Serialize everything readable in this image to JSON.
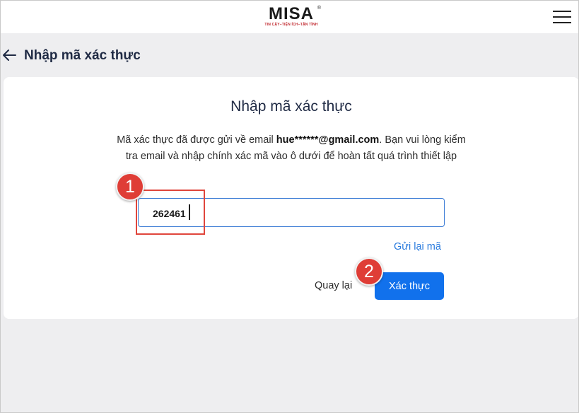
{
  "brand": {
    "logo_text": "MISA",
    "registered_mark": "®",
    "slogan": "TIN CẬY–TIỆN ÍCH–TẬN TÌNH"
  },
  "header": {
    "menu_icon": "hamburger-menu-icon",
    "back_icon": "arrow-left-icon",
    "title": "Nhập mã xác thực"
  },
  "card": {
    "title": "Nhập mã xác thực",
    "desc_prefix": "Mã xác thực đã được gửi về email ",
    "email": "hue******@gmail.com",
    "desc_suffix": ". Bạn vui lòng kiểm tra email và nhập chính xác mã vào ô dưới để hoàn tất quá trình thiết lập",
    "code_value": "262461",
    "resend_label": "Gửi lại mã",
    "back_label": "Quay lại",
    "verify_label": "Xác thực"
  },
  "annotations": {
    "step1": "1",
    "step2": "2",
    "badge_color": "#df3d36",
    "highlight_color": "#e0463c"
  },
  "colors": {
    "primary_button": "#1171ec",
    "link": "#2a7bde",
    "page_background": "#eeeef0"
  }
}
